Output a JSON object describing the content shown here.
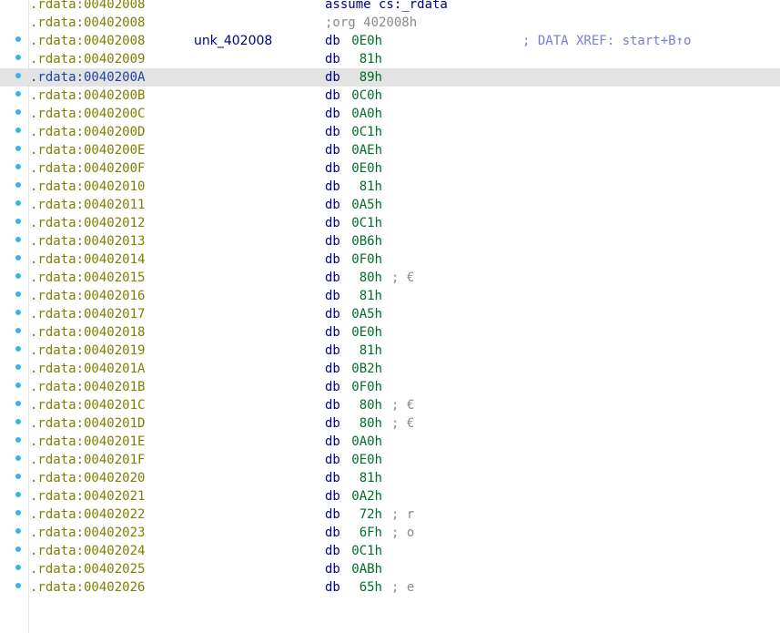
{
  "header_lines": [
    {
      "address": ".rdata:00402008",
      "text": "assume cs:_rdata",
      "kind": "directive"
    },
    {
      "address": ".rdata:00402008",
      "text": ";org 402008h",
      "kind": "comment"
    }
  ],
  "label_line": {
    "address": ".rdata:00402008",
    "label": "unk_402008",
    "mnemonic": "db",
    "operand": "0E0h",
    "xref": "; DATA XREF: start+B↑o"
  },
  "selected_address": ".rdata:0040200A",
  "colors": {
    "address": "#7f7f00",
    "address_selected": "#1c44a8",
    "mnemonic": "#000080",
    "operand": "#006e28",
    "comment": "#8a8a8a",
    "xref": "#7b7bd6",
    "selected_row_bg": "#e3e3e3",
    "gutter_dot": "#38b6e6"
  },
  "data_lines": [
    {
      "address": ".rdata:00402009",
      "mnemonic": "db",
      "operand": "81h",
      "comment": ""
    },
    {
      "address": ".rdata:0040200A",
      "mnemonic": "db",
      "operand": "89h",
      "comment": ""
    },
    {
      "address": ".rdata:0040200B",
      "mnemonic": "db",
      "operand": "0C0h",
      "comment": ""
    },
    {
      "address": ".rdata:0040200C",
      "mnemonic": "db",
      "operand": "0A0h",
      "comment": ""
    },
    {
      "address": ".rdata:0040200D",
      "mnemonic": "db",
      "operand": "0C1h",
      "comment": ""
    },
    {
      "address": ".rdata:0040200E",
      "mnemonic": "db",
      "operand": "0AEh",
      "comment": ""
    },
    {
      "address": ".rdata:0040200F",
      "mnemonic": "db",
      "operand": "0E0h",
      "comment": ""
    },
    {
      "address": ".rdata:00402010",
      "mnemonic": "db",
      "operand": "81h",
      "comment": ""
    },
    {
      "address": ".rdata:00402011",
      "mnemonic": "db",
      "operand": "0A5h",
      "comment": ""
    },
    {
      "address": ".rdata:00402012",
      "mnemonic": "db",
      "operand": "0C1h",
      "comment": ""
    },
    {
      "address": ".rdata:00402013",
      "mnemonic": "db",
      "operand": "0B6h",
      "comment": ""
    },
    {
      "address": ".rdata:00402014",
      "mnemonic": "db",
      "operand": "0F0h",
      "comment": ""
    },
    {
      "address": ".rdata:00402015",
      "mnemonic": "db",
      "operand": "80h",
      "comment": "; €"
    },
    {
      "address": ".rdata:00402016",
      "mnemonic": "db",
      "operand": "81h",
      "comment": ""
    },
    {
      "address": ".rdata:00402017",
      "mnemonic": "db",
      "operand": "0A5h",
      "comment": ""
    },
    {
      "address": ".rdata:00402018",
      "mnemonic": "db",
      "operand": "0E0h",
      "comment": ""
    },
    {
      "address": ".rdata:00402019",
      "mnemonic": "db",
      "operand": "81h",
      "comment": ""
    },
    {
      "address": ".rdata:0040201A",
      "mnemonic": "db",
      "operand": "0B2h",
      "comment": ""
    },
    {
      "address": ".rdata:0040201B",
      "mnemonic": "db",
      "operand": "0F0h",
      "comment": ""
    },
    {
      "address": ".rdata:0040201C",
      "mnemonic": "db",
      "operand": "80h",
      "comment": "; €"
    },
    {
      "address": ".rdata:0040201D",
      "mnemonic": "db",
      "operand": "80h",
      "comment": "; €"
    },
    {
      "address": ".rdata:0040201E",
      "mnemonic": "db",
      "operand": "0A0h",
      "comment": ""
    },
    {
      "address": ".rdata:0040201F",
      "mnemonic": "db",
      "operand": "0E0h",
      "comment": ""
    },
    {
      "address": ".rdata:00402020",
      "mnemonic": "db",
      "operand": "81h",
      "comment": ""
    },
    {
      "address": ".rdata:00402021",
      "mnemonic": "db",
      "operand": "0A2h",
      "comment": ""
    },
    {
      "address": ".rdata:00402022",
      "mnemonic": "db",
      "operand": "72h",
      "comment": "; r"
    },
    {
      "address": ".rdata:00402023",
      "mnemonic": "db",
      "operand": "6Fh",
      "comment": "; o"
    },
    {
      "address": ".rdata:00402024",
      "mnemonic": "db",
      "operand": "0C1h",
      "comment": ""
    },
    {
      "address": ".rdata:00402025",
      "mnemonic": "db",
      "operand": "0ABh",
      "comment": ""
    },
    {
      "address": ".rdata:00402026",
      "mnemonic": "db",
      "operand": "65h",
      "comment": "; e"
    }
  ]
}
